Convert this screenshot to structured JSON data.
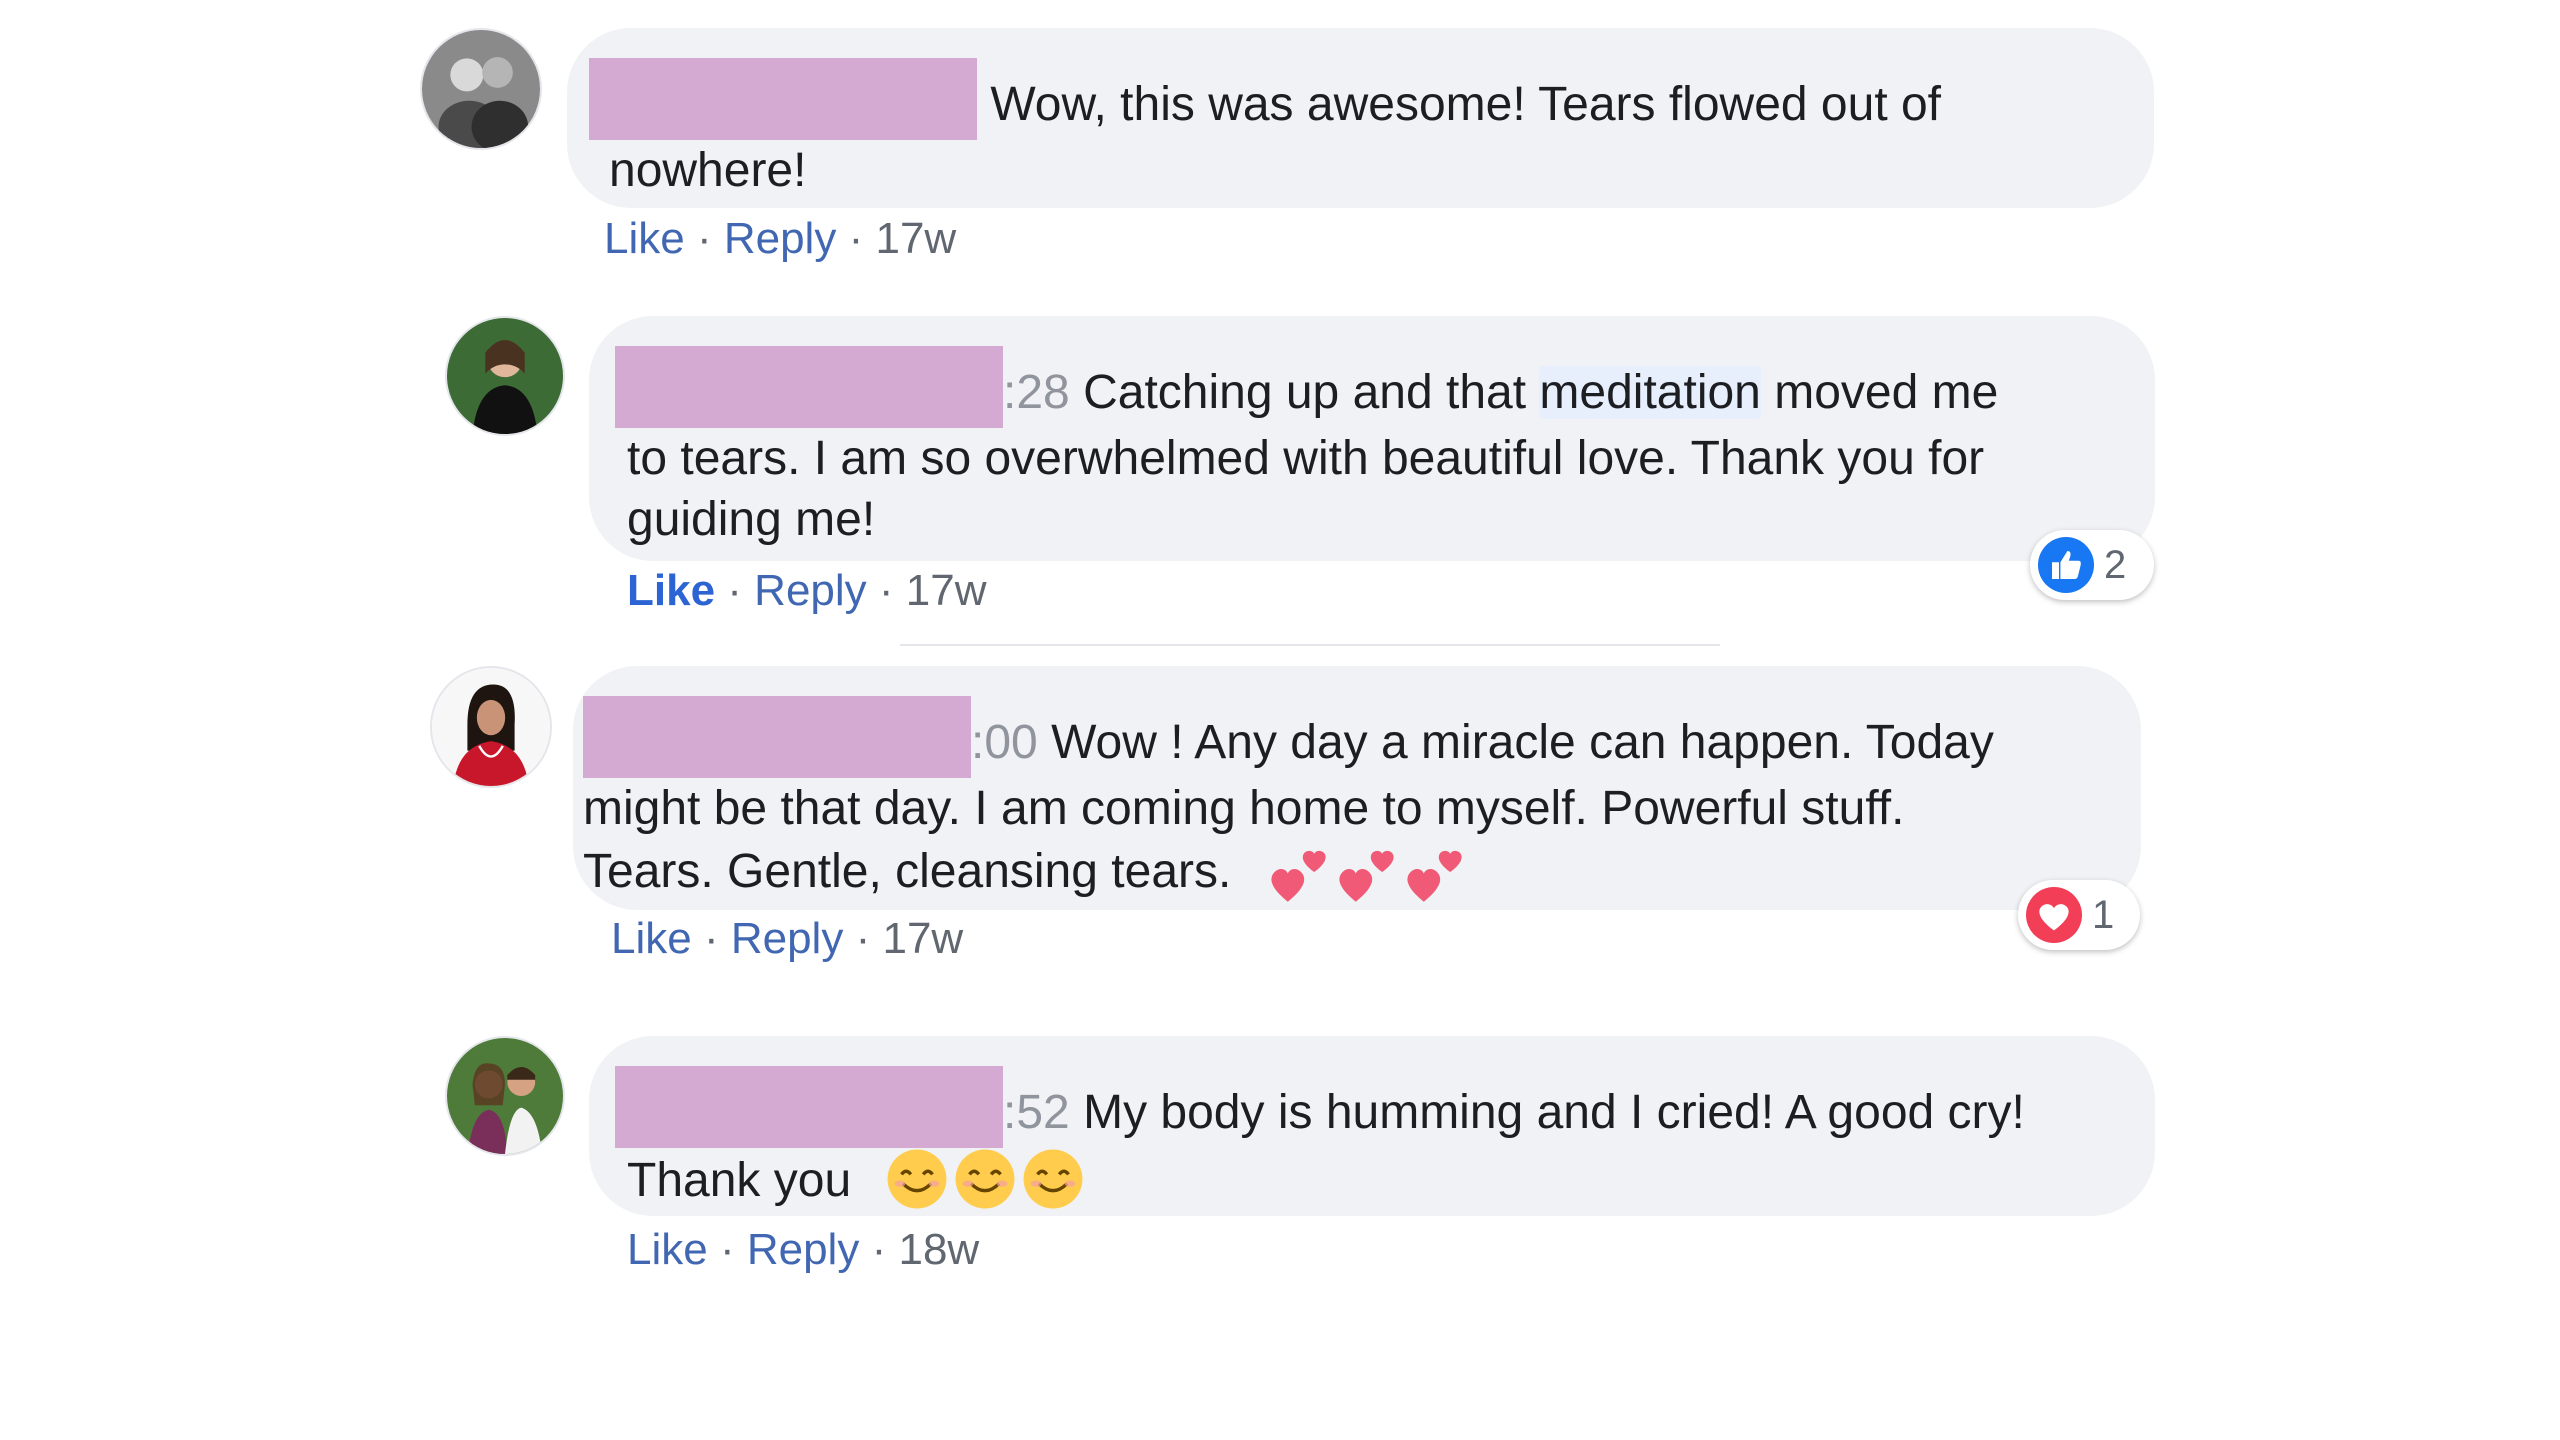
{
  "comments": [
    {
      "timestamp_fragment": "",
      "text": "Wow, this was awesome! Tears flowed out of",
      "text_line2": "nowhere!",
      "actions": {
        "like": "Like",
        "reply": "Reply",
        "age": "17w"
      }
    },
    {
      "timestamp_fragment": ":28",
      "text_before": "Catching up and that ",
      "text_highlight": "meditation",
      "text_after": " moved me",
      "text_line2": "to tears. I am so overwhelmed with beautiful love. Thank you for",
      "text_line3": "guiding me!",
      "actions": {
        "like": "Like",
        "reply": "Reply",
        "age": "17w"
      },
      "reaction": {
        "type": "like",
        "count": "2"
      }
    },
    {
      "timestamp_fragment": ":00",
      "text": "Wow ! Any day a miracle can happen. Today",
      "text_line2": "might be that day. I am coming home to myself. Powerful stuff.",
      "text_line3": "Tears. Gentle, cleansing tears.",
      "emoji": [
        "two-hearts-icon",
        "two-hearts-icon",
        "two-hearts-icon"
      ],
      "actions": {
        "like": "Like",
        "reply": "Reply",
        "age": "17w"
      },
      "reaction": {
        "type": "love",
        "count": "1"
      }
    },
    {
      "timestamp_fragment": ":52",
      "text": "My body is humming and I cried! A good cry!",
      "text_line2": "Thank you",
      "emoji": [
        "smiling-face-icon",
        "smiling-face-icon",
        "smiling-face-icon"
      ],
      "actions": {
        "like": "Like",
        "reply": "Reply",
        "age": "18w"
      }
    }
  ],
  "separator": "·",
  "colors": {
    "bubble": "#f0f2f5",
    "link": "#4267b2",
    "like_active": "#2d64d4",
    "redaction": "#d4aad2",
    "love": "#f33e58"
  }
}
